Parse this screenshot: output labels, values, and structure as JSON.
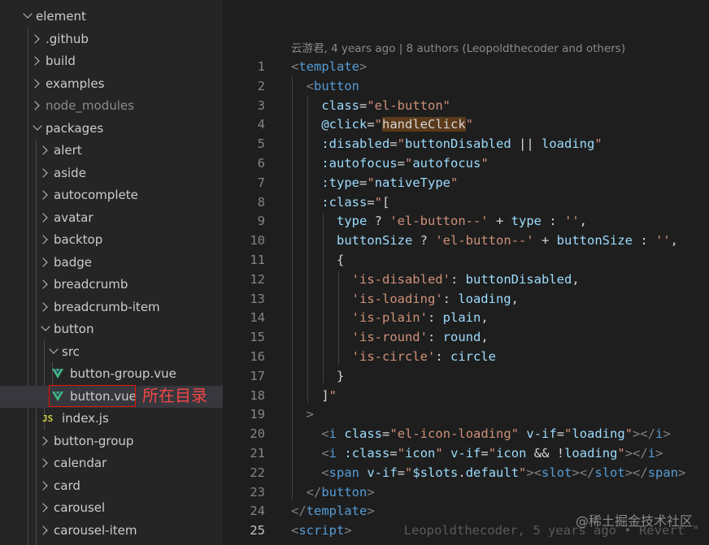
{
  "explorer": {
    "items": [
      {
        "label": "element",
        "state": "down",
        "indent": 0
      },
      {
        "label": ".github",
        "state": "right",
        "indent": 1
      },
      {
        "label": "build",
        "state": "right",
        "indent": 1
      },
      {
        "label": "examples",
        "state": "right",
        "indent": 1
      },
      {
        "label": "node_modules",
        "state": "right",
        "indent": 1,
        "dim": true
      },
      {
        "label": "packages",
        "state": "down",
        "indent": 1
      },
      {
        "label": "alert",
        "state": "right",
        "indent": 2
      },
      {
        "label": "aside",
        "state": "right",
        "indent": 2
      },
      {
        "label": "autocomplete",
        "state": "right",
        "indent": 2
      },
      {
        "label": "avatar",
        "state": "right",
        "indent": 2
      },
      {
        "label": "backtop",
        "state": "right",
        "indent": 2
      },
      {
        "label": "badge",
        "state": "right",
        "indent": 2
      },
      {
        "label": "breadcrumb",
        "state": "right",
        "indent": 2
      },
      {
        "label": "breadcrumb-item",
        "state": "right",
        "indent": 2
      },
      {
        "label": "button",
        "state": "down",
        "indent": 2
      },
      {
        "label": "src",
        "state": "down",
        "indent": 3
      },
      {
        "label": "button-group.vue",
        "state": "vue",
        "indent": 4
      },
      {
        "label": "button.vue",
        "state": "vue",
        "indent": 4,
        "selected": true
      },
      {
        "label": "index.js",
        "state": "js",
        "indent": 3
      },
      {
        "label": "button-group",
        "state": "right",
        "indent": 2
      },
      {
        "label": "calendar",
        "state": "right",
        "indent": 2
      },
      {
        "label": "card",
        "state": "right",
        "indent": 2
      },
      {
        "label": "carousel",
        "state": "right",
        "indent": 2
      },
      {
        "label": "carousel-item",
        "state": "right",
        "indent": 2
      }
    ],
    "annotation": "所在目录"
  },
  "editor": {
    "blame_header": "云游君, 4 years ago | 8 authors (Leopoldthecoder and others)",
    "inline_blame": "Leopoldthecoder, 5 years ago • Revert \"",
    "active_line": 25,
    "lines": [
      {
        "n": "1",
        "tokens": [
          [
            "t-punct",
            "<"
          ],
          [
            "t-tag",
            "template"
          ],
          [
            "t-punct",
            ">"
          ]
        ]
      },
      {
        "n": "2",
        "tokens": [
          [
            "t-text",
            "  "
          ],
          [
            "t-punct",
            "<"
          ],
          [
            "t-tag",
            "button"
          ]
        ]
      },
      {
        "n": "3",
        "tokens": [
          [
            "t-text",
            "    "
          ],
          [
            "t-attr",
            "class"
          ],
          [
            "t-text",
            "="
          ],
          [
            "t-str",
            "\"el-button\""
          ]
        ]
      },
      {
        "n": "4",
        "tokens": [
          [
            "t-text",
            "    "
          ],
          [
            "t-attr",
            "@click"
          ],
          [
            "t-text",
            "="
          ],
          [
            "t-str",
            "\""
          ],
          [
            "t-hl",
            "handleClick"
          ],
          [
            "t-str",
            "\""
          ]
        ]
      },
      {
        "n": "5",
        "tokens": [
          [
            "t-text",
            "    "
          ],
          [
            "t-attr",
            ":disabled"
          ],
          [
            "t-text",
            "="
          ],
          [
            "t-str",
            "\""
          ],
          [
            "t-var",
            "buttonDisabled"
          ],
          [
            "t-text",
            " || "
          ],
          [
            "t-var",
            "loading"
          ],
          [
            "t-str",
            "\""
          ]
        ]
      },
      {
        "n": "6",
        "tokens": [
          [
            "t-text",
            "    "
          ],
          [
            "t-attr",
            ":autofocus"
          ],
          [
            "t-text",
            "="
          ],
          [
            "t-str",
            "\""
          ],
          [
            "t-var",
            "autofocus"
          ],
          [
            "t-str",
            "\""
          ]
        ]
      },
      {
        "n": "7",
        "tokens": [
          [
            "t-text",
            "    "
          ],
          [
            "t-attr",
            ":type"
          ],
          [
            "t-text",
            "="
          ],
          [
            "t-str",
            "\""
          ],
          [
            "t-var",
            "nativeType"
          ],
          [
            "t-str",
            "\""
          ]
        ]
      },
      {
        "n": "8",
        "tokens": [
          [
            "t-text",
            "    "
          ],
          [
            "t-attr",
            ":class"
          ],
          [
            "t-text",
            "="
          ],
          [
            "t-str",
            "\""
          ],
          [
            "t-text",
            "["
          ]
        ]
      },
      {
        "n": "9",
        "tokens": [
          [
            "t-text",
            "      "
          ],
          [
            "t-var",
            "type"
          ],
          [
            "t-text",
            " ? "
          ],
          [
            "t-str",
            "'el-button--'"
          ],
          [
            "t-text",
            " + "
          ],
          [
            "t-var",
            "type"
          ],
          [
            "t-text",
            " : "
          ],
          [
            "t-str",
            "''"
          ],
          [
            "t-text",
            ","
          ]
        ]
      },
      {
        "n": "10",
        "tokens": [
          [
            "t-text",
            "      "
          ],
          [
            "t-var",
            "buttonSize"
          ],
          [
            "t-text",
            " ? "
          ],
          [
            "t-str",
            "'el-button--'"
          ],
          [
            "t-text",
            " + "
          ],
          [
            "t-var",
            "buttonSize"
          ],
          [
            "t-text",
            " : "
          ],
          [
            "t-str",
            "''"
          ],
          [
            "t-text",
            ","
          ]
        ]
      },
      {
        "n": "11",
        "tokens": [
          [
            "t-text",
            "      {"
          ]
        ]
      },
      {
        "n": "12",
        "tokens": [
          [
            "t-text",
            "        "
          ],
          [
            "t-str",
            "'is-disabled'"
          ],
          [
            "t-text",
            ": "
          ],
          [
            "t-var",
            "buttonDisabled"
          ],
          [
            "t-text",
            ","
          ]
        ]
      },
      {
        "n": "13",
        "tokens": [
          [
            "t-text",
            "        "
          ],
          [
            "t-str",
            "'is-loading'"
          ],
          [
            "t-text",
            ": "
          ],
          [
            "t-var",
            "loading"
          ],
          [
            "t-text",
            ","
          ]
        ]
      },
      {
        "n": "14",
        "tokens": [
          [
            "t-text",
            "        "
          ],
          [
            "t-str",
            "'is-plain'"
          ],
          [
            "t-text",
            ": "
          ],
          [
            "t-var",
            "plain"
          ],
          [
            "t-text",
            ","
          ]
        ]
      },
      {
        "n": "15",
        "tokens": [
          [
            "t-text",
            "        "
          ],
          [
            "t-str",
            "'is-round'"
          ],
          [
            "t-text",
            ": "
          ],
          [
            "t-var",
            "round"
          ],
          [
            "t-text",
            ","
          ]
        ]
      },
      {
        "n": "16",
        "tokens": [
          [
            "t-text",
            "        "
          ],
          [
            "t-str",
            "'is-circle'"
          ],
          [
            "t-text",
            ": "
          ],
          [
            "t-var",
            "circle"
          ]
        ]
      },
      {
        "n": "17",
        "tokens": [
          [
            "t-text",
            "      }"
          ]
        ]
      },
      {
        "n": "18",
        "tokens": [
          [
            "t-text",
            "    ]"
          ],
          [
            "t-str",
            "\""
          ]
        ]
      },
      {
        "n": "19",
        "tokens": [
          [
            "t-text",
            "  "
          ],
          [
            "t-punct",
            ">"
          ]
        ]
      },
      {
        "n": "20",
        "tokens": [
          [
            "t-text",
            "    "
          ],
          [
            "t-punct",
            "<"
          ],
          [
            "t-tag",
            "i"
          ],
          [
            "t-text",
            " "
          ],
          [
            "t-attr",
            "class"
          ],
          [
            "t-text",
            "="
          ],
          [
            "t-str",
            "\"el-icon-loading\""
          ],
          [
            "t-text",
            " "
          ],
          [
            "t-attr",
            "v-if"
          ],
          [
            "t-text",
            "="
          ],
          [
            "t-str",
            "\""
          ],
          [
            "t-var",
            "loading"
          ],
          [
            "t-str",
            "\""
          ],
          [
            "t-punct",
            "></"
          ],
          [
            "t-tag",
            "i"
          ],
          [
            "t-punct",
            ">"
          ]
        ]
      },
      {
        "n": "21",
        "tokens": [
          [
            "t-text",
            "    "
          ],
          [
            "t-punct",
            "<"
          ],
          [
            "t-tag",
            "i"
          ],
          [
            "t-text",
            " "
          ],
          [
            "t-attr",
            ":class"
          ],
          [
            "t-text",
            "="
          ],
          [
            "t-str",
            "\""
          ],
          [
            "t-var",
            "icon"
          ],
          [
            "t-str",
            "\""
          ],
          [
            "t-text",
            " "
          ],
          [
            "t-attr",
            "v-if"
          ],
          [
            "t-text",
            "="
          ],
          [
            "t-str",
            "\""
          ],
          [
            "t-var",
            "icon"
          ],
          [
            "t-text",
            " && !"
          ],
          [
            "t-var",
            "loading"
          ],
          [
            "t-str",
            "\""
          ],
          [
            "t-punct",
            "></"
          ],
          [
            "t-tag",
            "i"
          ],
          [
            "t-punct",
            ">"
          ]
        ]
      },
      {
        "n": "22",
        "tokens": [
          [
            "t-text",
            "    "
          ],
          [
            "t-punct",
            "<"
          ],
          [
            "t-tag",
            "span"
          ],
          [
            "t-text",
            " "
          ],
          [
            "t-attr",
            "v-if"
          ],
          [
            "t-text",
            "="
          ],
          [
            "t-str",
            "\""
          ],
          [
            "t-var",
            "$slots"
          ],
          [
            "t-text",
            "."
          ],
          [
            "t-var",
            "default"
          ],
          [
            "t-str",
            "\""
          ],
          [
            "t-punct",
            "><"
          ],
          [
            "t-tag",
            "slot"
          ],
          [
            "t-punct",
            "></"
          ],
          [
            "t-tag",
            "slot"
          ],
          [
            "t-punct",
            "></"
          ],
          [
            "t-tag",
            "span"
          ],
          [
            "t-punct",
            ">"
          ]
        ]
      },
      {
        "n": "23",
        "tokens": [
          [
            "t-text",
            "  "
          ],
          [
            "t-punct",
            "</"
          ],
          [
            "t-tag",
            "button"
          ],
          [
            "t-punct",
            ">"
          ]
        ]
      },
      {
        "n": "24",
        "tokens": [
          [
            "t-punct",
            "</"
          ],
          [
            "t-tag",
            "template"
          ],
          [
            "t-punct",
            ">"
          ]
        ]
      },
      {
        "n": "25",
        "tokens": [
          [
            "t-punct",
            "<"
          ],
          [
            "t-tag",
            "script"
          ],
          [
            "t-punct",
            ">"
          ]
        ]
      }
    ]
  },
  "watermark": "@稀土掘金技术社区",
  "colors": {
    "selection_border": "#e51400",
    "annotation": "#f44747"
  }
}
